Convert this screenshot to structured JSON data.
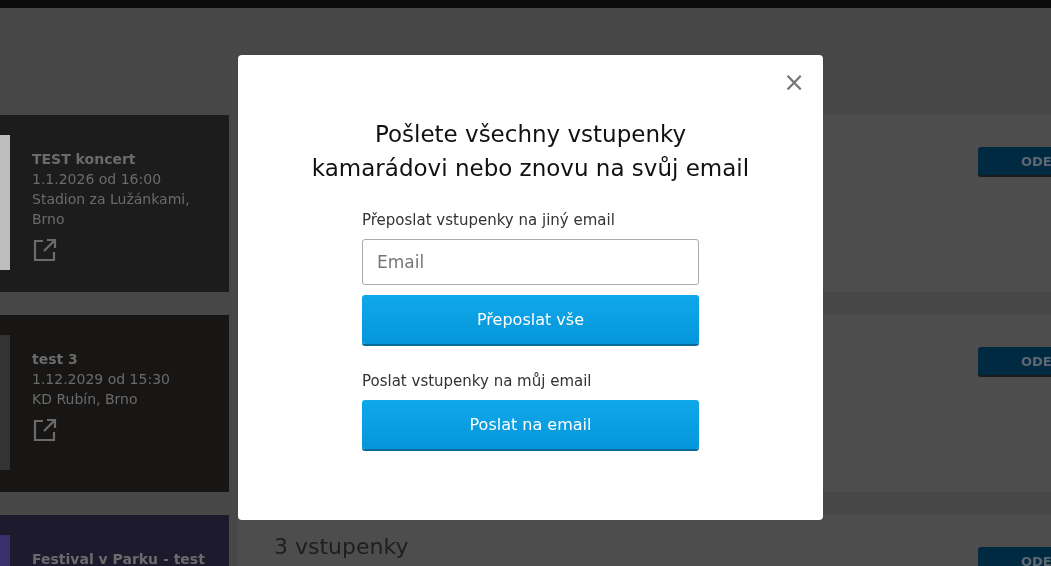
{
  "events": [
    {
      "title": "TEST koncert",
      "lines": [
        "1.1.2026 od 16:00",
        "Stadion za Lužánkami, Brno"
      ],
      "button": "ODE"
    },
    {
      "title": "test 3",
      "lines": [
        "1.12.2029 od 15:30",
        "KD Rubín, Brno"
      ],
      "button": "ODE"
    },
    {
      "title": "Festival v Parku - test",
      "tickets": "3 vstupenky",
      "button": "ODE"
    }
  ],
  "modal": {
    "close": "×",
    "title": "Pošlete všechny vstupenky kamarádovi nebo znovu na svůj email",
    "forward_label": "Přeposlat vstupenky na jiný email",
    "email_placeholder": "Email",
    "forward_button": "Přeposlat vše",
    "self_label": "Poslat vstupenky na můj email",
    "self_button": "Poslat na email"
  }
}
